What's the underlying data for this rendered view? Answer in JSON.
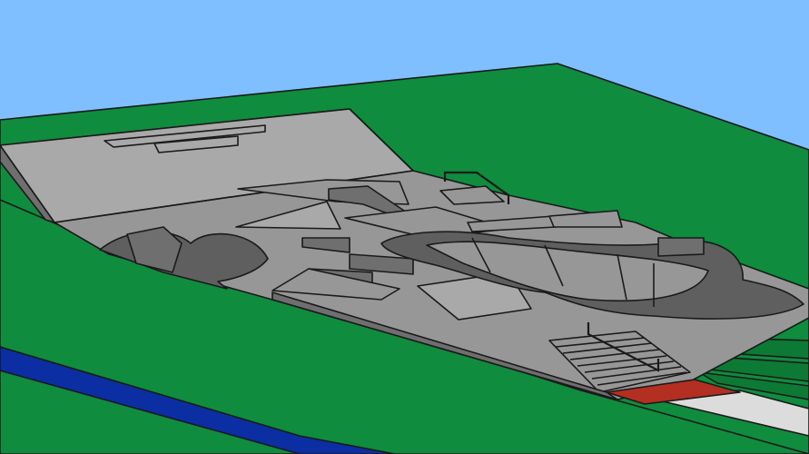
{
  "scene": {
    "subject": "skatepark-3d-render",
    "colors": {
      "sky": "#80bfff",
      "grass": "#0f8c3e",
      "grass_dark": "#0c7a35",
      "concrete": "#979797",
      "concrete_light": "#a9a9a9",
      "concrete_dark": "#6f6f6f",
      "concrete_shadow": "#5f5f5f",
      "water": "#0b2ea3",
      "path": "#dcdcdc",
      "red_pad": "#b22f22",
      "outline": "#1a1a1a"
    }
  }
}
